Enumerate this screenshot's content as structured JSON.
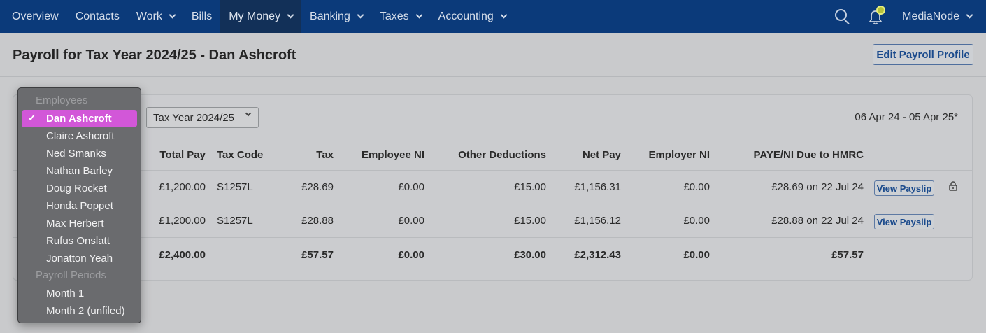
{
  "nav": {
    "items": [
      {
        "label": "Overview",
        "dropdown": false
      },
      {
        "label": "Contacts",
        "dropdown": false
      },
      {
        "label": "Work",
        "dropdown": true
      },
      {
        "label": "Bills",
        "dropdown": false
      },
      {
        "label": "My Money",
        "dropdown": true,
        "active": true
      },
      {
        "label": "Banking",
        "dropdown": true
      },
      {
        "label": "Taxes",
        "dropdown": true
      },
      {
        "label": "Accounting",
        "dropdown": true
      }
    ],
    "org_name": "MediaNode"
  },
  "header": {
    "title": "Payroll for Tax Year 2024/25 - Dan Ashcroft",
    "edit_button": "Edit Payroll Profile"
  },
  "filters": {
    "tax_year": "Tax Year 2024/25",
    "date_range": "06 Apr 24 - 05 Apr 25*"
  },
  "table": {
    "columns": [
      "Total Pay",
      "Tax Code",
      "Tax",
      "Employee NI",
      "Other Deductions",
      "Net Pay",
      "Employer NI",
      "PAYE/NI Due to HMRC"
    ],
    "rows": [
      {
        "total_pay": "£1,200.00",
        "tax_code": "S1257L",
        "tax": "£28.69",
        "employee_ni": "£0.00",
        "other_deductions": "£15.00",
        "net_pay": "£1,156.31",
        "employer_ni": "£0.00",
        "due": "£28.69 on 22 Jul 24",
        "action": "View Payslip",
        "locked": true
      },
      {
        "total_pay": "£1,200.00",
        "tax_code": "S1257L",
        "tax": "£28.88",
        "employee_ni": "£0.00",
        "other_deductions": "£15.00",
        "net_pay": "£1,156.12",
        "employer_ni": "£0.00",
        "due": "£28.88 on 22 Jul 24",
        "action": "View Payslip",
        "locked": false
      }
    ],
    "totals": {
      "total_pay": "£2,400.00",
      "tax": "£57.57",
      "employee_ni": "£0.00",
      "other_deductions": "£30.00",
      "net_pay": "£2,312.43",
      "employer_ni": "£0.00",
      "due": "£57.57"
    }
  },
  "menu": {
    "employees_heading": "Employees",
    "employees": [
      "Dan Ashcroft",
      "Claire Ashcroft",
      "Ned Smanks",
      "Nathan Barley",
      "Doug Rocket",
      "Honda Poppet",
      "Max Herbert",
      "Rufus Onslatt",
      "Jonatton Yeah"
    ],
    "selected_employee": "Dan Ashcroft",
    "periods_heading": "Payroll Periods",
    "periods": [
      "Month 1",
      "Month 2 (unfiled)"
    ],
    "check_glyph": "✓"
  },
  "colors": {
    "nav_bg": "#0b3a7a",
    "highlight": "#d257d8",
    "link": "#1a4a8c"
  }
}
